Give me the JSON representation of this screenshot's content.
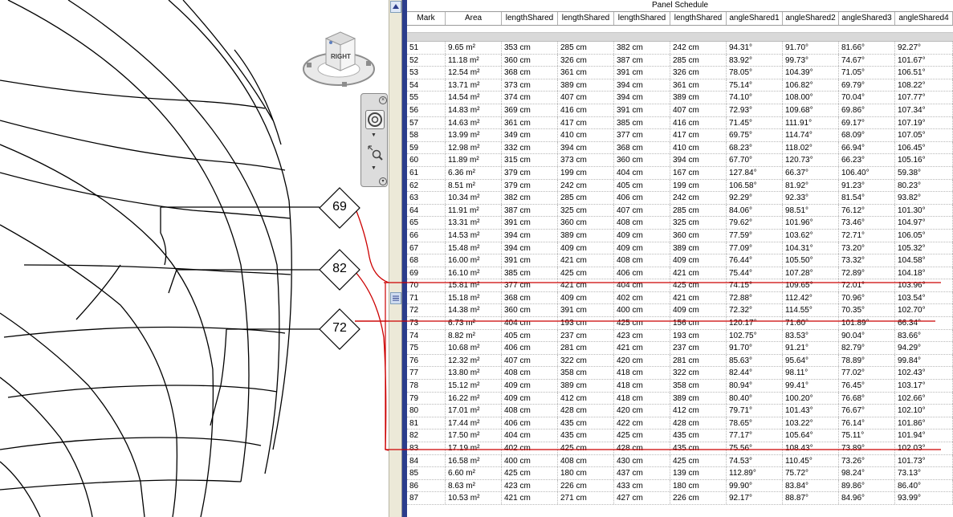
{
  "schedule": {
    "title": "Panel Schedule",
    "columns": [
      "Mark",
      "Area",
      "lengthShared",
      "lengthShared",
      "lengthShared",
      "lengthShared",
      "angleShared1",
      "angleShared2",
      "angleShared3",
      "angleShared4"
    ],
    "rows": [
      [
        "51",
        "9.65 m²",
        "353 cm",
        "285 cm",
        "382 cm",
        "242 cm",
        "94.31°",
        "91.70°",
        "81.66°",
        "92.27°"
      ],
      [
        "52",
        "11.18 m²",
        "360 cm",
        "326 cm",
        "387 cm",
        "285 cm",
        "83.92°",
        "99.73°",
        "74.67°",
        "101.67°"
      ],
      [
        "53",
        "12.54 m²",
        "368 cm",
        "361 cm",
        "391 cm",
        "326 cm",
        "78.05°",
        "104.39°",
        "71.05°",
        "106.51°"
      ],
      [
        "54",
        "13.71 m²",
        "373 cm",
        "389 cm",
        "394 cm",
        "361 cm",
        "75.14°",
        "106.82°",
        "69.79°",
        "108.22°"
      ],
      [
        "55",
        "14.54 m²",
        "374 cm",
        "407 cm",
        "394 cm",
        "389 cm",
        "74.10°",
        "108.00°",
        "70.04°",
        "107.77°"
      ],
      [
        "56",
        "14.83 m²",
        "369 cm",
        "416 cm",
        "391 cm",
        "407 cm",
        "72.93°",
        "109.68°",
        "69.86°",
        "107.34°"
      ],
      [
        "57",
        "14.63 m²",
        "361 cm",
        "417 cm",
        "385 cm",
        "416 cm",
        "71.45°",
        "111.91°",
        "69.17°",
        "107.19°"
      ],
      [
        "58",
        "13.99 m²",
        "349 cm",
        "410 cm",
        "377 cm",
        "417 cm",
        "69.75°",
        "114.74°",
        "68.09°",
        "107.05°"
      ],
      [
        "59",
        "12.98 m²",
        "332 cm",
        "394 cm",
        "368 cm",
        "410 cm",
        "68.23°",
        "118.02°",
        "66.94°",
        "106.45°"
      ],
      [
        "60",
        "11.89 m²",
        "315 cm",
        "373 cm",
        "360 cm",
        "394 cm",
        "67.70°",
        "120.73°",
        "66.23°",
        "105.16°"
      ],
      [
        "61",
        "6.36 m²",
        "379 cm",
        "199 cm",
        "404 cm",
        "167 cm",
        "127.84°",
        "66.37°",
        "106.40°",
        "59.38°"
      ],
      [
        "62",
        "8.51 m²",
        "379 cm",
        "242 cm",
        "405 cm",
        "199 cm",
        "106.58°",
        "81.92°",
        "91.23°",
        "80.23°"
      ],
      [
        "63",
        "10.34 m²",
        "382 cm",
        "285 cm",
        "406 cm",
        "242 cm",
        "92.29°",
        "92.33°",
        "81.54°",
        "93.82°"
      ],
      [
        "64",
        "11.91 m²",
        "387 cm",
        "325 cm",
        "407 cm",
        "285 cm",
        "84.06°",
        "98.51°",
        "76.12°",
        "101.30°"
      ],
      [
        "65",
        "13.31 m²",
        "391 cm",
        "360 cm",
        "408 cm",
        "325 cm",
        "79.62°",
        "101.96°",
        "73.46°",
        "104.97°"
      ],
      [
        "66",
        "14.53 m²",
        "394 cm",
        "389 cm",
        "409 cm",
        "360 cm",
        "77.59°",
        "103.62°",
        "72.71°",
        "106.05°"
      ],
      [
        "67",
        "15.48 m²",
        "394 cm",
        "409 cm",
        "409 cm",
        "389 cm",
        "77.09°",
        "104.31°",
        "73.20°",
        "105.32°"
      ],
      [
        "68",
        "16.00 m²",
        "391 cm",
        "421 cm",
        "408 cm",
        "409 cm",
        "76.44°",
        "105.50°",
        "73.32°",
        "104.58°"
      ],
      [
        "69",
        "16.10 m²",
        "385 cm",
        "425 cm",
        "406 cm",
        "421 cm",
        "75.44°",
        "107.28°",
        "72.89°",
        "104.18°"
      ],
      [
        "70",
        "15.81 m²",
        "377 cm",
        "421 cm",
        "404 cm",
        "425 cm",
        "74.15°",
        "109.65°",
        "72.01°",
        "103.96°"
      ],
      [
        "71",
        "15.18 m²",
        "368 cm",
        "409 cm",
        "402 cm",
        "421 cm",
        "72.88°",
        "112.42°",
        "70.96°",
        "103.54°"
      ],
      [
        "72",
        "14.38 m²",
        "360 cm",
        "391 cm",
        "400 cm",
        "409 cm",
        "72.32°",
        "114.55°",
        "70.35°",
        "102.70°"
      ],
      [
        "73",
        "6.73 m²",
        "404 cm",
        "193 cm",
        "425 cm",
        "156 cm",
        "120.17°",
        "71.60°",
        "101.89°",
        "66.34°"
      ],
      [
        "74",
        "8.82 m²",
        "405 cm",
        "237 cm",
        "423 cm",
        "193 cm",
        "102.75°",
        "83.53°",
        "90.04°",
        "83.66°"
      ],
      [
        "75",
        "10.68 m²",
        "406 cm",
        "281 cm",
        "421 cm",
        "237 cm",
        "91.70°",
        "91.21°",
        "82.79°",
        "94.29°"
      ],
      [
        "76",
        "12.32 m²",
        "407 cm",
        "322 cm",
        "420 cm",
        "281 cm",
        "85.63°",
        "95.64°",
        "78.89°",
        "99.84°"
      ],
      [
        "77",
        "13.80 m²",
        "408 cm",
        "358 cm",
        "418 cm",
        "322 cm",
        "82.44°",
        "98.11°",
        "77.02°",
        "102.43°"
      ],
      [
        "78",
        "15.12 m²",
        "409 cm",
        "389 cm",
        "418 cm",
        "358 cm",
        "80.94°",
        "99.41°",
        "76.45°",
        "103.17°"
      ],
      [
        "79",
        "16.22 m²",
        "409 cm",
        "412 cm",
        "418 cm",
        "389 cm",
        "80.40°",
        "100.20°",
        "76.68°",
        "102.66°"
      ],
      [
        "80",
        "17.01 m²",
        "408 cm",
        "428 cm",
        "420 cm",
        "412 cm",
        "79.71°",
        "101.43°",
        "76.67°",
        "102.10°"
      ],
      [
        "81",
        "17.44 m²",
        "406 cm",
        "435 cm",
        "422 cm",
        "428 cm",
        "78.65°",
        "103.22°",
        "76.14°",
        "101.86°"
      ],
      [
        "82",
        "17.50 m²",
        "404 cm",
        "435 cm",
        "425 cm",
        "435 cm",
        "77.17°",
        "105.64°",
        "75.11°",
        "101.94°"
      ],
      [
        "83",
        "17.19 m²",
        "402 cm",
        "425 cm",
        "428 cm",
        "435 cm",
        "75.56°",
        "108.43°",
        "73.89°",
        "102.03°"
      ],
      [
        "84",
        "16.58 m²",
        "400 cm",
        "408 cm",
        "430 cm",
        "425 cm",
        "74.53°",
        "110.45°",
        "73.26°",
        "101.73°"
      ],
      [
        "85",
        "6.60 m²",
        "425 cm",
        "180 cm",
        "437 cm",
        "139 cm",
        "112.89°",
        "75.72°",
        "98.24°",
        "73.13°"
      ],
      [
        "86",
        "8.63 m²",
        "423 cm",
        "226 cm",
        "433 cm",
        "180 cm",
        "99.90°",
        "83.84°",
        "89.86°",
        "86.40°"
      ],
      [
        "87",
        "10.53 m²",
        "421 cm",
        "271 cm",
        "427 cm",
        "226 cm",
        "92.17°",
        "88.87°",
        "84.96°",
        "93.99°"
      ]
    ]
  },
  "viewport": {
    "tags": [
      "69",
      "82",
      "72"
    ],
    "viewcube_label": "RIGHT"
  },
  "colors": {
    "leader_red": "#cc0000",
    "panel_edge": "#2b3d8c",
    "group_row": "#d9d9d9"
  }
}
